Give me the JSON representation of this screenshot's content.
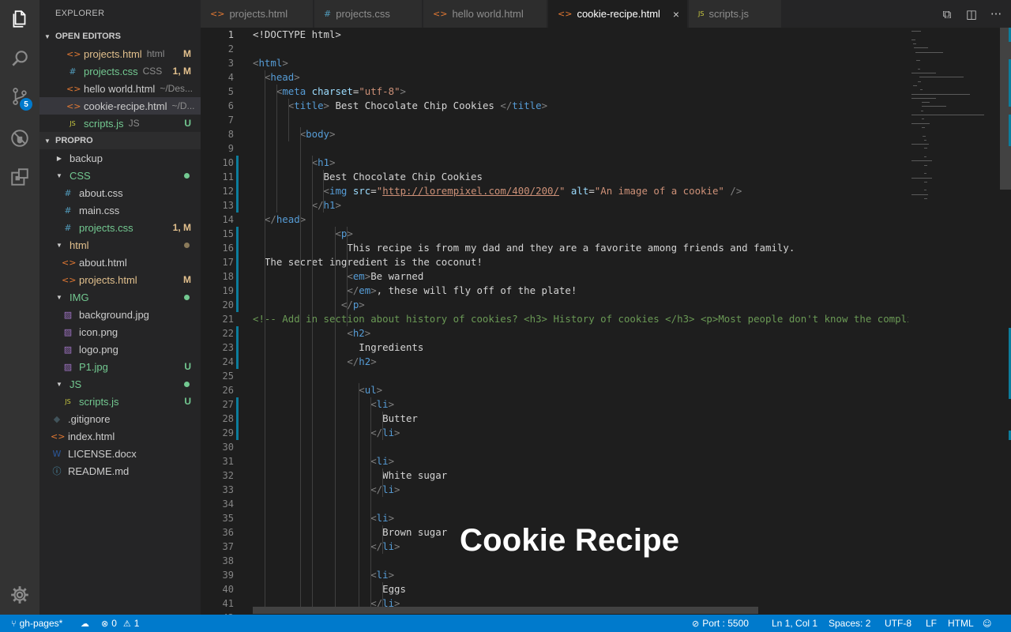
{
  "sidebar": {
    "title": "EXPLORER",
    "open_editors_header": "OPEN EDITORS",
    "open_editors": [
      {
        "name": "projects.html",
        "desc": "html",
        "status": "M",
        "icon": "html-file-icon",
        "color": "#e2c08d",
        "status_color": "#e2c08d"
      },
      {
        "name": "projects.css",
        "desc": "CSS",
        "status": "1, M",
        "icon": "css-file-icon",
        "color": "#73c991",
        "status_color": "#e2c08d"
      },
      {
        "name": "hello world.html",
        "desc": "~/Des...",
        "status": "",
        "icon": "html-file-icon",
        "color": "#cccccc",
        "status_color": ""
      },
      {
        "name": "cookie-recipe.html",
        "desc": "~/D...",
        "status": "",
        "icon": "html-file-icon",
        "color": "#cccccc",
        "status_color": ""
      },
      {
        "name": "scripts.js",
        "desc": "JS",
        "status": "U",
        "icon": "js-file-icon",
        "color": "#73c991",
        "status_color": "#73c991"
      }
    ],
    "project_header": "PROPRO",
    "tree": [
      {
        "name": "backup",
        "type": "folder",
        "open": false,
        "depth": 0,
        "color": "#cccccc",
        "status": "",
        "status_color": ""
      },
      {
        "name": "CSS",
        "type": "folder",
        "open": true,
        "depth": 0,
        "color": "#73c991",
        "status": "dot",
        "status_color": "#73c991"
      },
      {
        "name": "about.css",
        "type": "css",
        "depth": 1,
        "color": "#cccccc",
        "status": "",
        "status_color": ""
      },
      {
        "name": "main.css",
        "type": "css",
        "depth": 1,
        "color": "#cccccc",
        "status": "",
        "status_color": ""
      },
      {
        "name": "projects.css",
        "type": "css",
        "depth": 1,
        "color": "#73c991",
        "status": "1, M",
        "status_color": "#e2c08d"
      },
      {
        "name": "html",
        "type": "folder",
        "open": true,
        "depth": 0,
        "color": "#e2c08d",
        "status": "dot",
        "status_color": "#8a7a5a"
      },
      {
        "name": "about.html",
        "type": "html",
        "depth": 1,
        "color": "#cccccc",
        "status": "",
        "status_color": ""
      },
      {
        "name": "projects.html",
        "type": "html",
        "depth": 1,
        "color": "#e2c08d",
        "status": "M",
        "status_color": "#e2c08d"
      },
      {
        "name": "IMG",
        "type": "folder",
        "open": true,
        "depth": 0,
        "color": "#73c991",
        "status": "dot",
        "status_color": "#73c991"
      },
      {
        "name": "background.jpg",
        "type": "img",
        "depth": 1,
        "color": "#cccccc",
        "status": "",
        "status_color": ""
      },
      {
        "name": "icon.png",
        "type": "img",
        "depth": 1,
        "color": "#cccccc",
        "status": "",
        "status_color": ""
      },
      {
        "name": "logo.png",
        "type": "img",
        "depth": 1,
        "color": "#cccccc",
        "status": "",
        "status_color": ""
      },
      {
        "name": "P1.jpg",
        "type": "img",
        "depth": 1,
        "color": "#73c991",
        "status": "U",
        "status_color": "#73c991"
      },
      {
        "name": "JS",
        "type": "folder",
        "open": true,
        "depth": 0,
        "color": "#73c991",
        "status": "dot",
        "status_color": "#73c991"
      },
      {
        "name": "scripts.js",
        "type": "js",
        "depth": 1,
        "color": "#73c991",
        "status": "U",
        "status_color": "#73c991"
      },
      {
        "name": ".gitignore",
        "type": "git",
        "depth": -1,
        "color": "#cccccc",
        "status": "",
        "status_color": ""
      },
      {
        "name": "index.html",
        "type": "html",
        "depth": -1,
        "color": "#cccccc",
        "status": "",
        "status_color": ""
      },
      {
        "name": "LICENSE.docx",
        "type": "docx",
        "depth": -1,
        "color": "#cccccc",
        "status": "",
        "status_color": ""
      },
      {
        "name": "README.md",
        "type": "info",
        "depth": -1,
        "color": "#cccccc",
        "status": "",
        "status_color": ""
      }
    ]
  },
  "activity": {
    "scm_badge": "5",
    "icons": [
      "files-icon",
      "search-icon",
      "source-control-icon",
      "debug-icon",
      "extensions-icon",
      "settings-gear-icon"
    ]
  },
  "tabs": [
    {
      "label": "projects.html",
      "icon": "html-file-icon",
      "active": false
    },
    {
      "label": "projects.css",
      "icon": "css-file-icon",
      "active": false
    },
    {
      "label": "hello world.html",
      "icon": "html-file-icon",
      "active": false
    },
    {
      "label": "cookie-recipe.html",
      "icon": "html-file-icon",
      "active": true
    },
    {
      "label": "scripts.js",
      "icon": "js-file-icon",
      "active": false
    }
  ],
  "editor": {
    "current_line": 1,
    "lines": [
      [
        [
          "t-txt",
          "<!DOCTYPE html>"
        ]
      ],
      [],
      [
        [
          "t-gray",
          "<"
        ],
        [
          "t-tag",
          "html"
        ],
        [
          "t-gray",
          ">"
        ]
      ],
      [
        [
          "t-txt",
          "  "
        ],
        [
          "t-gray",
          "<"
        ],
        [
          "t-tag",
          "head"
        ],
        [
          "t-gray",
          ">"
        ]
      ],
      [
        [
          "t-txt",
          "    "
        ],
        [
          "t-gray",
          "<"
        ],
        [
          "t-tag",
          "meta"
        ],
        [
          "t-txt",
          " "
        ],
        [
          "t-attr",
          "charset"
        ],
        [
          "t-txt",
          "="
        ],
        [
          "t-str",
          "\"utf-8\""
        ],
        [
          "t-gray",
          ">"
        ]
      ],
      [
        [
          "t-txt",
          "      "
        ],
        [
          "t-gray",
          "<"
        ],
        [
          "t-tag",
          "title"
        ],
        [
          "t-gray",
          ">"
        ],
        [
          "t-txt",
          " Best Chocolate Chip Cookies "
        ],
        [
          "t-gray",
          "</"
        ],
        [
          "t-tag",
          "title"
        ],
        [
          "t-gray",
          ">"
        ]
      ],
      [],
      [
        [
          "t-txt",
          "        "
        ],
        [
          "t-gray",
          "<"
        ],
        [
          "t-tag",
          "body"
        ],
        [
          "t-gray",
          ">"
        ]
      ],
      [],
      [
        [
          "t-txt",
          "          "
        ],
        [
          "t-gray",
          "<"
        ],
        [
          "t-tag",
          "h1"
        ],
        [
          "t-gray",
          ">"
        ]
      ],
      [
        [
          "t-txt",
          "            Best Chocolate Chip Cookies"
        ]
      ],
      [
        [
          "t-txt",
          "            "
        ],
        [
          "t-gray",
          "<"
        ],
        [
          "t-tag",
          "img"
        ],
        [
          "t-txt",
          " "
        ],
        [
          "t-attr",
          "src"
        ],
        [
          "t-txt",
          "="
        ],
        [
          "t-str",
          "\""
        ],
        [
          "t-url",
          "http://lorempixel.com/400/200/"
        ],
        [
          "t-str",
          "\""
        ],
        [
          "t-txt",
          " "
        ],
        [
          "t-attr",
          "alt"
        ],
        [
          "t-txt",
          "="
        ],
        [
          "t-str",
          "\"An image of a cookie\""
        ],
        [
          "t-txt",
          " "
        ],
        [
          "t-gray",
          "/>"
        ]
      ],
      [
        [
          "t-txt",
          "          "
        ],
        [
          "t-gray",
          "</"
        ],
        [
          "t-tag",
          "h1"
        ],
        [
          "t-gray",
          ">"
        ]
      ],
      [
        [
          "t-txt",
          "  "
        ],
        [
          "t-gray",
          "</"
        ],
        [
          "t-tag",
          "head"
        ],
        [
          "t-gray",
          ">"
        ]
      ],
      [
        [
          "t-txt",
          "              "
        ],
        [
          "t-gray",
          "<"
        ],
        [
          "t-tag",
          "p"
        ],
        [
          "t-gray",
          ">"
        ]
      ],
      [
        [
          "t-txt",
          "                This recipe is from my dad and they are a favorite among friends and family."
        ]
      ],
      [
        [
          "t-txt",
          "  The secret ingredient is the coconut!"
        ]
      ],
      [
        [
          "t-txt",
          "                "
        ],
        [
          "t-gray",
          "<"
        ],
        [
          "t-tag",
          "em"
        ],
        [
          "t-gray",
          ">"
        ],
        [
          "t-txt",
          "Be warned"
        ]
      ],
      [
        [
          "t-txt",
          "                "
        ],
        [
          "t-gray",
          "</"
        ],
        [
          "t-tag",
          "em"
        ],
        [
          "t-gray",
          ">"
        ],
        [
          "t-txt",
          ", these will fly off of the plate!"
        ]
      ],
      [
        [
          "t-txt",
          "               "
        ],
        [
          "t-gray",
          "</"
        ],
        [
          "t-tag",
          "p"
        ],
        [
          "t-gray",
          ">"
        ]
      ],
      [
        [
          "t-cmt",
          "<!-- Add in section about history of cookies? <h3> History of cookies </h3> <p>Most people don't know the complicat"
        ]
      ],
      [
        [
          "t-txt",
          "                "
        ],
        [
          "t-gray",
          "<"
        ],
        [
          "t-tag",
          "h2"
        ],
        [
          "t-gray",
          ">"
        ]
      ],
      [
        [
          "t-txt",
          "                  Ingredients"
        ]
      ],
      [
        [
          "t-txt",
          "                "
        ],
        [
          "t-gray",
          "</"
        ],
        [
          "t-tag",
          "h2"
        ],
        [
          "t-gray",
          ">"
        ]
      ],
      [],
      [
        [
          "t-txt",
          "                  "
        ],
        [
          "t-gray",
          "<"
        ],
        [
          "t-tag",
          "ul"
        ],
        [
          "t-gray",
          ">"
        ]
      ],
      [
        [
          "t-txt",
          "                    "
        ],
        [
          "t-gray",
          "<"
        ],
        [
          "t-tag",
          "li"
        ],
        [
          "t-gray",
          ">"
        ]
      ],
      [
        [
          "t-txt",
          "                      Butter"
        ]
      ],
      [
        [
          "t-txt",
          "                    "
        ],
        [
          "t-gray",
          "</"
        ],
        [
          "t-tag",
          "li"
        ],
        [
          "t-gray",
          ">"
        ]
      ],
      [],
      [
        [
          "t-txt",
          "                    "
        ],
        [
          "t-gray",
          "<"
        ],
        [
          "t-tag",
          "li"
        ],
        [
          "t-gray",
          ">"
        ]
      ],
      [
        [
          "t-txt",
          "                      White sugar"
        ]
      ],
      [
        [
          "t-txt",
          "                    "
        ],
        [
          "t-gray",
          "</"
        ],
        [
          "t-tag",
          "li"
        ],
        [
          "t-gray",
          ">"
        ]
      ],
      [],
      [
        [
          "t-txt",
          "                    "
        ],
        [
          "t-gray",
          "<"
        ],
        [
          "t-tag",
          "li"
        ],
        [
          "t-gray",
          ">"
        ]
      ],
      [
        [
          "t-txt",
          "                      Brown sugar"
        ]
      ],
      [
        [
          "t-txt",
          "                    "
        ],
        [
          "t-gray",
          "</"
        ],
        [
          "t-tag",
          "li"
        ],
        [
          "t-gray",
          ">"
        ]
      ],
      [],
      [
        [
          "t-txt",
          "                    "
        ],
        [
          "t-gray",
          "<"
        ],
        [
          "t-tag",
          "li"
        ],
        [
          "t-gray",
          ">"
        ]
      ],
      [
        [
          "t-txt",
          "                      Eggs"
        ]
      ],
      [
        [
          "t-txt",
          "                    "
        ],
        [
          "t-gray",
          "</"
        ],
        [
          "t-tag",
          "li"
        ],
        [
          "t-gray",
          ">"
        ]
      ],
      []
    ],
    "modified_lines": [
      10,
      11,
      12,
      13,
      15,
      16,
      17,
      18,
      19,
      20,
      22,
      23,
      24,
      27,
      28,
      29
    ]
  },
  "overlay_caption": "Cookie Recipe",
  "statusbar": {
    "branch": "gh-pages*",
    "errors": "0",
    "warnings": "1",
    "port": "Port : 5500",
    "position": "Ln 1, Col 1",
    "spaces": "Spaces: 2",
    "encoding": "UTF-8",
    "eol": "LF",
    "language": "HTML"
  },
  "colors": {
    "accent": "#007acc",
    "modified": "#e2c08d",
    "untracked": "#73c991"
  }
}
